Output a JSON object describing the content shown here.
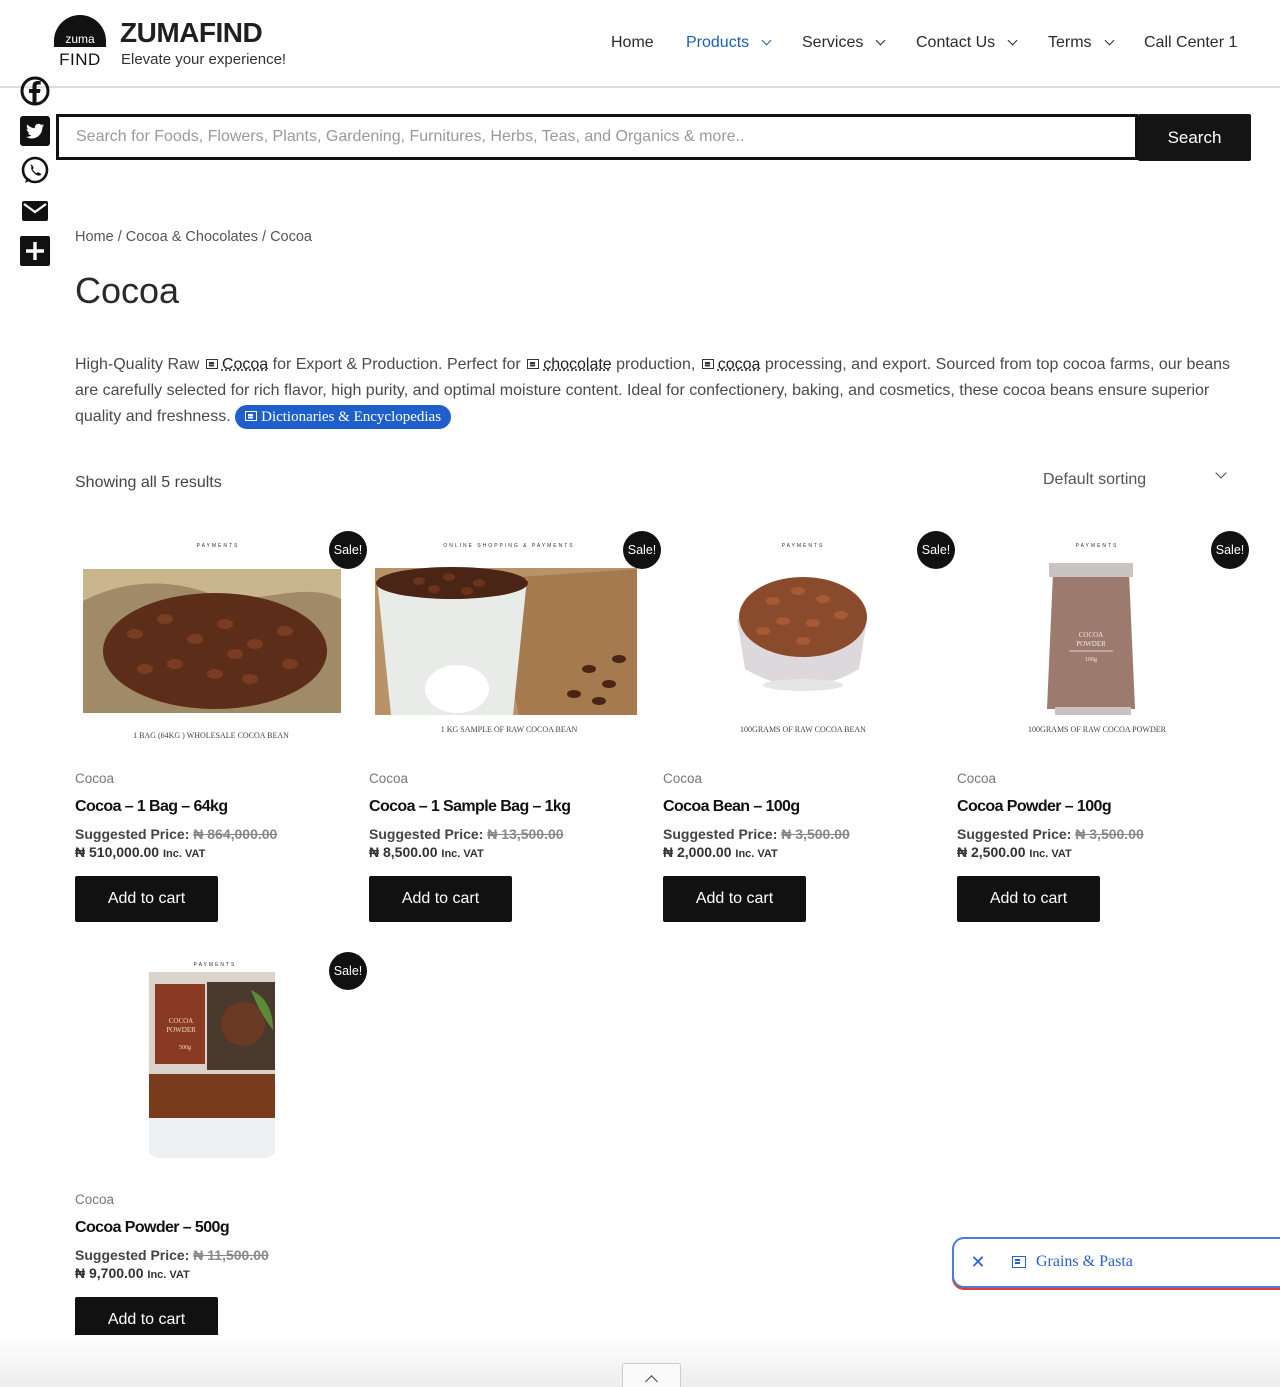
{
  "brand": {
    "logo_top": "zuma",
    "logo_bottom": "FIND",
    "name": "ZUMAFIND",
    "tagline": "Elevate your experience!"
  },
  "nav": [
    {
      "label": "Home",
      "dropdown": false,
      "active": false
    },
    {
      "label": "Products",
      "dropdown": true,
      "active": true
    },
    {
      "label": "Services",
      "dropdown": true,
      "active": false
    },
    {
      "label": "Contact Us",
      "dropdown": true,
      "active": false
    },
    {
      "label": "Terms",
      "dropdown": true,
      "active": false
    },
    {
      "label": "Call Center 1",
      "dropdown": false,
      "active": false
    }
  ],
  "social": [
    "facebook-icon",
    "twitter-icon",
    "whatsapp-icon",
    "email-icon",
    "share-plus-icon"
  ],
  "search": {
    "placeholder": "Search for Foods, Flowers, Plants, Gardening, Furnitures, Herbs, Teas, and Organics & more..",
    "button": "Search"
  },
  "breadcrumb": [
    "Home",
    "Cocoa & Chocolates",
    "Cocoa"
  ],
  "title": "Cocoa",
  "description": {
    "p1": "High-Quality Raw ",
    "kw1": "Cocoa",
    "p2": " for Export & Production. Perfect for ",
    "kw2": "chocolate",
    "p3": " production, ",
    "kw3": "cocoa",
    "p4": " processing, and export. Sourced from top cocoa farms, our beans are carefully selected for rich flavor, high purity, and optimal moisture content. Ideal for confectionery, baking, and cosmetics, these cocoa beans ensure superior quality and freshness.",
    "pill": "Dictionaries & Encyclopedias"
  },
  "results_count": "Showing all 5 results",
  "sorting": "Default sorting",
  "products": [
    {
      "category": "Cocoa",
      "name": "Cocoa – 1 Bag – 64kg",
      "price_label": "Suggested Price:",
      "old_price": "₦ 864,000.00",
      "new_price": "₦ 510,000.00",
      "vat": "Inc. VAT",
      "badge": "Sale!",
      "button": "Add to cart",
      "image_header": "PAYMENTS",
      "image_caption": "1 BAG (64KG ) WHOLESALE COCOA BEAN"
    },
    {
      "category": "Cocoa",
      "name": "Cocoa – 1 Sample Bag – 1kg",
      "price_label": "Suggested Price:",
      "old_price": "₦ 13,500.00",
      "new_price": "₦ 8,500.00",
      "vat": "Inc. VAT",
      "badge": "Sale!",
      "button": "Add to cart",
      "image_header": "ONLINE SHOPPING & PAYMENTS",
      "image_caption": "1 KG SAMPLE OF RAW COCOA BEAN"
    },
    {
      "category": "Cocoa",
      "name": "Cocoa Bean – 100g",
      "price_label": "Suggested Price:",
      "old_price": "₦ 3,500.00",
      "new_price": "₦ 2,000.00",
      "vat": "Inc. VAT",
      "badge": "Sale!",
      "button": "Add to cart",
      "image_header": "PAYMENTS",
      "image_caption": "100GRAMS OF RAW COCOA BEAN"
    },
    {
      "category": "Cocoa",
      "name": "Cocoa Powder – 100g",
      "price_label": "Suggested Price:",
      "old_price": "₦ 3,500.00",
      "new_price": "₦ 2,500.00",
      "vat": "Inc. VAT",
      "badge": "Sale!",
      "button": "Add to cart",
      "image_header": "PAYMENTS",
      "image_caption": "100GRAMS OF RAW COCOA POWDER"
    },
    {
      "category": "Cocoa",
      "name": "Cocoa Powder – 500g",
      "price_label": "Suggested Price:",
      "old_price": "₦ 11,500.00",
      "new_price": "₦ 9,700.00",
      "vat": "Inc. VAT",
      "badge": "Sale!",
      "button": "Add to cart",
      "image_header": "PAYMENTS",
      "image_caption": ""
    }
  ],
  "chip": {
    "label": "Grains & Pasta",
    "close_icon": "close-icon"
  },
  "colors": {
    "accent": "#1d5fb3",
    "pill": "#1f5fcc",
    "button": "#111111",
    "cocoa": "#6b3a23"
  }
}
